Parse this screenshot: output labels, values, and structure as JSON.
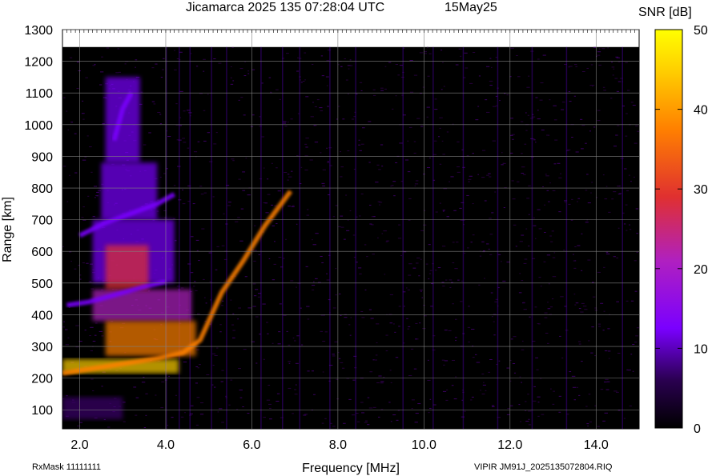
{
  "chart_data": {
    "type": "heatmap",
    "title_left": "Jicamarca 2025 135 07:28:04 UTC",
    "title_right": "15May25",
    "xlabel": "Frequency [MHz]",
    "ylabel": "Range [km]",
    "colorbar_label": "SNR [dB]",
    "footer_left": "RxMask 11111111",
    "footer_right": "VIPIR  JM91J_2025135072804.RIQ",
    "xlim": [
      1.6,
      15.0
    ],
    "ylim": [
      40,
      1300
    ],
    "data_max_range": 1245,
    "x_ticks": [
      "2.0",
      "4.0",
      "6.0",
      "8.0",
      "10.0",
      "12.0",
      "14.0"
    ],
    "y_ticks": [
      "100",
      "200",
      "300",
      "400",
      "500",
      "600",
      "700",
      "800",
      "900",
      "1000",
      "1100",
      "1200",
      "1300"
    ],
    "colorbar_ticks": [
      "0",
      "10",
      "20",
      "30",
      "40",
      "50"
    ],
    "colorbar_range": [
      0,
      50
    ],
    "colormap": [
      "#000000",
      "#3a006a",
      "#7a00ff",
      "#b020c0",
      "#e03030",
      "#ff8000",
      "#ffd000",
      "#ffff00"
    ],
    "background_color": "#000000",
    "grid": true,
    "echo_traces": [
      {
        "name_hidden": "",
        "points": [
          [
            1.6,
            215
          ],
          [
            2.2,
            228
          ],
          [
            3.0,
            245
          ],
          [
            3.8,
            262
          ],
          [
            4.4,
            280
          ],
          [
            4.8,
            320
          ],
          [
            5.0,
            380
          ],
          [
            5.3,
            470
          ],
          [
            5.8,
            570
          ],
          [
            6.3,
            680
          ],
          [
            6.9,
            790
          ]
        ],
        "snr": 38
      },
      {
        "points": [
          [
            1.7,
            430
          ],
          [
            2.2,
            440
          ],
          [
            2.8,
            462
          ],
          [
            3.4,
            485
          ],
          [
            4.0,
            505
          ]
        ],
        "snr": 14
      },
      {
        "points": [
          [
            2.0,
            650
          ],
          [
            2.6,
            690
          ],
          [
            3.2,
            720
          ],
          [
            3.8,
            750
          ],
          [
            4.2,
            780
          ]
        ],
        "snr": 14
      },
      {
        "points": [
          [
            2.8,
            950
          ],
          [
            3.0,
            1050
          ],
          [
            3.2,
            1100
          ]
        ],
        "snr": 13
      }
    ],
    "hotspots": [
      {
        "x": [
          1.6,
          4.3
        ],
        "y": [
          215,
          260
        ],
        "snr": 44
      },
      {
        "x": [
          2.6,
          4.7
        ],
        "y": [
          270,
          380
        ],
        "snr": 34
      },
      {
        "x": [
          2.6,
          3.6
        ],
        "y": [
          480,
          620
        ],
        "snr": 27
      },
      {
        "x": [
          2.3,
          4.6
        ],
        "y": [
          380,
          480
        ],
        "snr": 18
      },
      {
        "x": [
          2.3,
          4.2
        ],
        "y": [
          500,
          700
        ],
        "snr": 15
      },
      {
        "x": [
          2.5,
          3.8
        ],
        "y": [
          700,
          880
        ],
        "snr": 12
      },
      {
        "x": [
          2.6,
          3.4
        ],
        "y": [
          880,
          1150
        ],
        "snr": 11
      },
      {
        "x": [
          1.6,
          3.0
        ],
        "y": [
          70,
          140
        ],
        "snr": 9
      }
    ],
    "vertical_streaks": [
      4.0,
      4.3,
      4.55,
      5.05,
      5.4,
      6.2,
      6.7,
      7.1,
      7.8,
      8.4,
      9.5,
      10.2,
      10.9,
      11.7,
      12.5,
      13.3,
      14.6
    ]
  }
}
